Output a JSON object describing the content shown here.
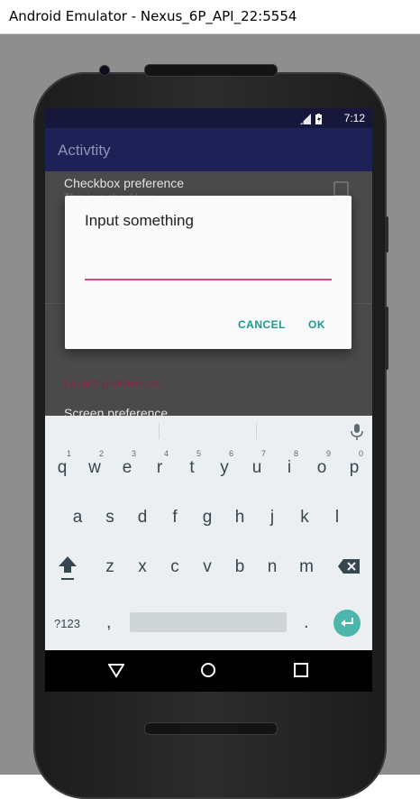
{
  "window": {
    "title": "Android Emulator - Nexus_6P_API_22:5554"
  },
  "status_bar": {
    "time": "7:12",
    "icons": [
      "signal-icon",
      "battery-icon"
    ]
  },
  "app_bar": {
    "title": "Activtity"
  },
  "preferences": {
    "checkbox_pref": {
      "title": "Checkbox preference",
      "summary": "This is a checkbox"
    },
    "category_header": "Launch preferences",
    "screen_pref": {
      "title": "Screen preference"
    }
  },
  "dialog": {
    "title": "Input something",
    "input_value": "",
    "cancel_label": "CANCEL",
    "ok_label": "OK"
  },
  "keyboard": {
    "row1": [
      {
        "key": "q",
        "hint": "1"
      },
      {
        "key": "w",
        "hint": "2"
      },
      {
        "key": "e",
        "hint": "3"
      },
      {
        "key": "r",
        "hint": "4"
      },
      {
        "key": "t",
        "hint": "5"
      },
      {
        "key": "y",
        "hint": "6"
      },
      {
        "key": "u",
        "hint": "7"
      },
      {
        "key": "i",
        "hint": "8"
      },
      {
        "key": "o",
        "hint": "9"
      },
      {
        "key": "p",
        "hint": "0"
      }
    ],
    "row2": [
      "a",
      "s",
      "d",
      "f",
      "g",
      "h",
      "j",
      "k",
      "l"
    ],
    "row3": [
      "z",
      "x",
      "c",
      "v",
      "b",
      "n",
      "m"
    ],
    "symbols_label": "?123",
    "comma": ",",
    "period": "."
  },
  "colors": {
    "accent": "#1a9a8c",
    "input_underline": "#d94a7a",
    "app_bar": "#1e2156",
    "status_bar": "#16173b",
    "enter_key": "#4db6ac"
  }
}
